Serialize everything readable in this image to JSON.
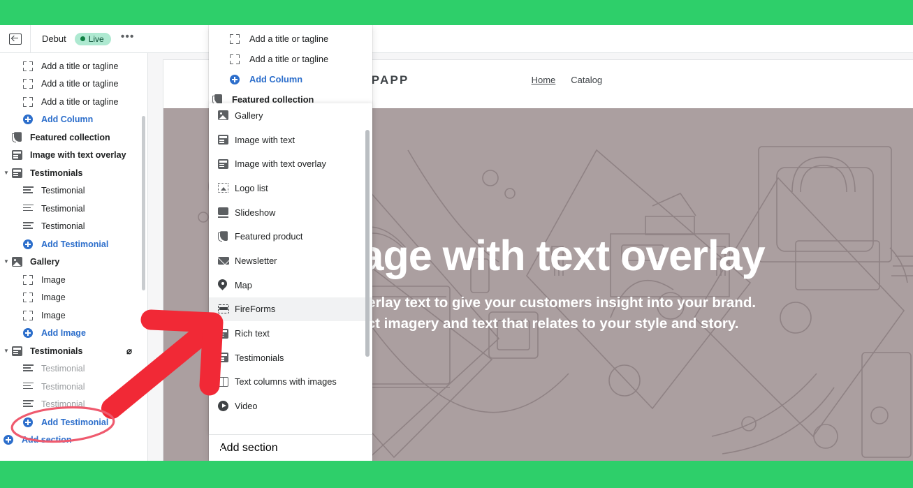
{
  "frame": {
    "accent_green": "#2ecf6a"
  },
  "toolbar": {
    "back_icon": "exit-icon",
    "theme_name": "Debut",
    "status_label": "Live",
    "more_label": "•••"
  },
  "sidebar": {
    "items": [
      {
        "label": "Add a title or tagline",
        "icon": "frame-icon",
        "level": "child",
        "state": "normal"
      },
      {
        "label": "Add a title or tagline",
        "icon": "frame-icon",
        "level": "child",
        "state": "normal"
      },
      {
        "label": "Add a title or tagline",
        "icon": "frame-icon",
        "level": "child",
        "state": "normal"
      },
      {
        "label": "Add Column",
        "icon": "plus-circle-icon",
        "level": "child",
        "state": "link"
      },
      {
        "label": "Featured collection",
        "icon": "tag-icon",
        "level": "group",
        "state": "normal"
      },
      {
        "label": "Image with text overlay",
        "icon": "section-icon",
        "level": "group",
        "state": "normal"
      },
      {
        "label": "Testimonials",
        "icon": "section-icon",
        "level": "group",
        "state": "expanded"
      },
      {
        "label": "Testimonial",
        "icon": "text-lines-icon",
        "level": "child",
        "state": "normal"
      },
      {
        "label": "Testimonial",
        "icon": "text-lines-icon",
        "level": "child",
        "state": "normal"
      },
      {
        "label": "Testimonial",
        "icon": "text-lines-icon",
        "level": "child",
        "state": "normal"
      },
      {
        "label": "Add Testimonial",
        "icon": "plus-circle-icon",
        "level": "child",
        "state": "link"
      },
      {
        "label": "Gallery",
        "icon": "image-icon",
        "level": "group",
        "state": "expanded"
      },
      {
        "label": "Image",
        "icon": "frame-icon",
        "level": "child",
        "state": "normal"
      },
      {
        "label": "Image",
        "icon": "frame-icon",
        "level": "child",
        "state": "normal"
      },
      {
        "label": "Image",
        "icon": "frame-icon",
        "level": "child",
        "state": "normal"
      },
      {
        "label": "Add Image",
        "icon": "plus-circle-icon",
        "level": "child",
        "state": "link"
      },
      {
        "label": "Testimonials",
        "icon": "section-icon",
        "level": "group",
        "state": "hidden",
        "eye": "eye-off-icon"
      },
      {
        "label": "Testimonial",
        "icon": "text-lines-icon",
        "level": "child",
        "state": "dimmed"
      },
      {
        "label": "Testimonial",
        "icon": "text-lines-icon",
        "level": "child",
        "state": "dimmed"
      },
      {
        "label": "Testimonial",
        "icon": "text-lines-icon",
        "level": "child",
        "state": "dimmed"
      },
      {
        "label": "Add Testimonial",
        "icon": "plus-circle-icon",
        "level": "child",
        "state": "link"
      },
      {
        "label": "Add section",
        "icon": "plus-circle-icon",
        "level": "group",
        "state": "link"
      }
    ]
  },
  "picker": {
    "top_items": [
      {
        "label": "Add a title or tagline",
        "icon": "frame-icon",
        "state": "normal"
      },
      {
        "label": "Add a title or tagline",
        "icon": "frame-icon",
        "state": "normal"
      },
      {
        "label": "Add Column",
        "icon": "plus-circle-icon",
        "state": "link"
      },
      {
        "label": "Featured collection",
        "icon": "tag-icon",
        "state": "bold"
      }
    ],
    "list_items": [
      {
        "label": "Gallery",
        "icon": "image-icon",
        "selected": false
      },
      {
        "label": "Image with text",
        "icon": "section-icon",
        "selected": false
      },
      {
        "label": "Image with text overlay",
        "icon": "section-icon",
        "selected": false
      },
      {
        "label": "Logo list",
        "icon": "logo-list-icon",
        "selected": false
      },
      {
        "label": "Slideshow",
        "icon": "slideshow-icon",
        "selected": false
      },
      {
        "label": "Featured product",
        "icon": "tag-icon",
        "selected": false
      },
      {
        "label": "Newsletter",
        "icon": "mail-icon",
        "selected": false
      },
      {
        "label": "Map",
        "icon": "map-pin-icon",
        "selected": false
      },
      {
        "label": "FireForms",
        "icon": "fireforms-icon",
        "selected": true
      },
      {
        "label": "Rich text",
        "icon": "section-icon",
        "selected": false
      },
      {
        "label": "Testimonials",
        "icon": "section-icon",
        "selected": false
      },
      {
        "label": "Text columns with images",
        "icon": "columns-icon",
        "selected": false
      },
      {
        "label": "Video",
        "icon": "video-icon",
        "selected": false
      }
    ],
    "footer_label": "Add section",
    "footer_icon": "plus-circle-icon"
  },
  "preview": {
    "store_name": "TESTSTORECOMPAPP",
    "nav": [
      {
        "label": "Home",
        "active": true
      },
      {
        "label": "Catalog",
        "active": false
      }
    ],
    "hero": {
      "title": "Image with text overlay",
      "subtitle_line1": "Use overlay text to give your customers insight into your brand.",
      "subtitle_line2": "Select imagery and text that relates to your style and story.",
      "background_color": "#ab9fa0",
      "text_color": "#ffffff"
    }
  },
  "annotations": {
    "arrow_color": "#f12936",
    "ellipse_color": "#ef5a6e",
    "arrow_target": "FireForms",
    "ellipse_target": "Add Testimonial"
  }
}
